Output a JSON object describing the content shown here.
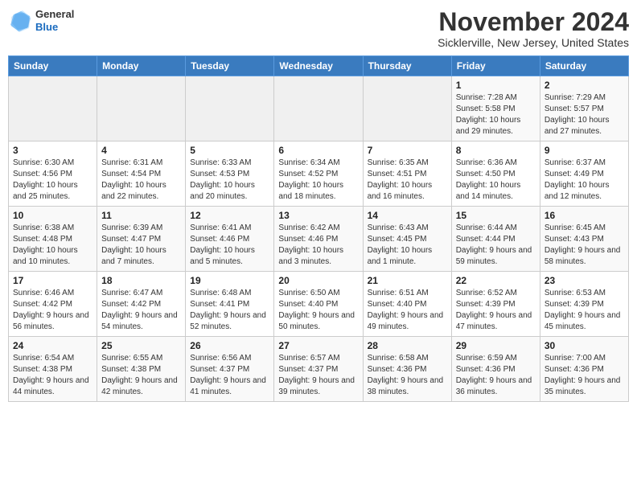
{
  "logo": {
    "general": "General",
    "blue": "Blue"
  },
  "title": "November 2024",
  "subtitle": "Sicklerville, New Jersey, United States",
  "days_of_week": [
    "Sunday",
    "Monday",
    "Tuesday",
    "Wednesday",
    "Thursday",
    "Friday",
    "Saturday"
  ],
  "weeks": [
    [
      {
        "day": "",
        "info": ""
      },
      {
        "day": "",
        "info": ""
      },
      {
        "day": "",
        "info": ""
      },
      {
        "day": "",
        "info": ""
      },
      {
        "day": "",
        "info": ""
      },
      {
        "day": "1",
        "info": "Sunrise: 7:28 AM\nSunset: 5:58 PM\nDaylight: 10 hours and 29 minutes."
      },
      {
        "day": "2",
        "info": "Sunrise: 7:29 AM\nSunset: 5:57 PM\nDaylight: 10 hours and 27 minutes."
      }
    ],
    [
      {
        "day": "3",
        "info": "Sunrise: 6:30 AM\nSunset: 4:56 PM\nDaylight: 10 hours and 25 minutes."
      },
      {
        "day": "4",
        "info": "Sunrise: 6:31 AM\nSunset: 4:54 PM\nDaylight: 10 hours and 22 minutes."
      },
      {
        "day": "5",
        "info": "Sunrise: 6:33 AM\nSunset: 4:53 PM\nDaylight: 10 hours and 20 minutes."
      },
      {
        "day": "6",
        "info": "Sunrise: 6:34 AM\nSunset: 4:52 PM\nDaylight: 10 hours and 18 minutes."
      },
      {
        "day": "7",
        "info": "Sunrise: 6:35 AM\nSunset: 4:51 PM\nDaylight: 10 hours and 16 minutes."
      },
      {
        "day": "8",
        "info": "Sunrise: 6:36 AM\nSunset: 4:50 PM\nDaylight: 10 hours and 14 minutes."
      },
      {
        "day": "9",
        "info": "Sunrise: 6:37 AM\nSunset: 4:49 PM\nDaylight: 10 hours and 12 minutes."
      }
    ],
    [
      {
        "day": "10",
        "info": "Sunrise: 6:38 AM\nSunset: 4:48 PM\nDaylight: 10 hours and 10 minutes."
      },
      {
        "day": "11",
        "info": "Sunrise: 6:39 AM\nSunset: 4:47 PM\nDaylight: 10 hours and 7 minutes."
      },
      {
        "day": "12",
        "info": "Sunrise: 6:41 AM\nSunset: 4:46 PM\nDaylight: 10 hours and 5 minutes."
      },
      {
        "day": "13",
        "info": "Sunrise: 6:42 AM\nSunset: 4:46 PM\nDaylight: 10 hours and 3 minutes."
      },
      {
        "day": "14",
        "info": "Sunrise: 6:43 AM\nSunset: 4:45 PM\nDaylight: 10 hours and 1 minute."
      },
      {
        "day": "15",
        "info": "Sunrise: 6:44 AM\nSunset: 4:44 PM\nDaylight: 9 hours and 59 minutes."
      },
      {
        "day": "16",
        "info": "Sunrise: 6:45 AM\nSunset: 4:43 PM\nDaylight: 9 hours and 58 minutes."
      }
    ],
    [
      {
        "day": "17",
        "info": "Sunrise: 6:46 AM\nSunset: 4:42 PM\nDaylight: 9 hours and 56 minutes."
      },
      {
        "day": "18",
        "info": "Sunrise: 6:47 AM\nSunset: 4:42 PM\nDaylight: 9 hours and 54 minutes."
      },
      {
        "day": "19",
        "info": "Sunrise: 6:48 AM\nSunset: 4:41 PM\nDaylight: 9 hours and 52 minutes."
      },
      {
        "day": "20",
        "info": "Sunrise: 6:50 AM\nSunset: 4:40 PM\nDaylight: 9 hours and 50 minutes."
      },
      {
        "day": "21",
        "info": "Sunrise: 6:51 AM\nSunset: 4:40 PM\nDaylight: 9 hours and 49 minutes."
      },
      {
        "day": "22",
        "info": "Sunrise: 6:52 AM\nSunset: 4:39 PM\nDaylight: 9 hours and 47 minutes."
      },
      {
        "day": "23",
        "info": "Sunrise: 6:53 AM\nSunset: 4:39 PM\nDaylight: 9 hours and 45 minutes."
      }
    ],
    [
      {
        "day": "24",
        "info": "Sunrise: 6:54 AM\nSunset: 4:38 PM\nDaylight: 9 hours and 44 minutes."
      },
      {
        "day": "25",
        "info": "Sunrise: 6:55 AM\nSunset: 4:38 PM\nDaylight: 9 hours and 42 minutes."
      },
      {
        "day": "26",
        "info": "Sunrise: 6:56 AM\nSunset: 4:37 PM\nDaylight: 9 hours and 41 minutes."
      },
      {
        "day": "27",
        "info": "Sunrise: 6:57 AM\nSunset: 4:37 PM\nDaylight: 9 hours and 39 minutes."
      },
      {
        "day": "28",
        "info": "Sunrise: 6:58 AM\nSunset: 4:36 PM\nDaylight: 9 hours and 38 minutes."
      },
      {
        "day": "29",
        "info": "Sunrise: 6:59 AM\nSunset: 4:36 PM\nDaylight: 9 hours and 36 minutes."
      },
      {
        "day": "30",
        "info": "Sunrise: 7:00 AM\nSunset: 4:36 PM\nDaylight: 9 hours and 35 minutes."
      }
    ]
  ]
}
